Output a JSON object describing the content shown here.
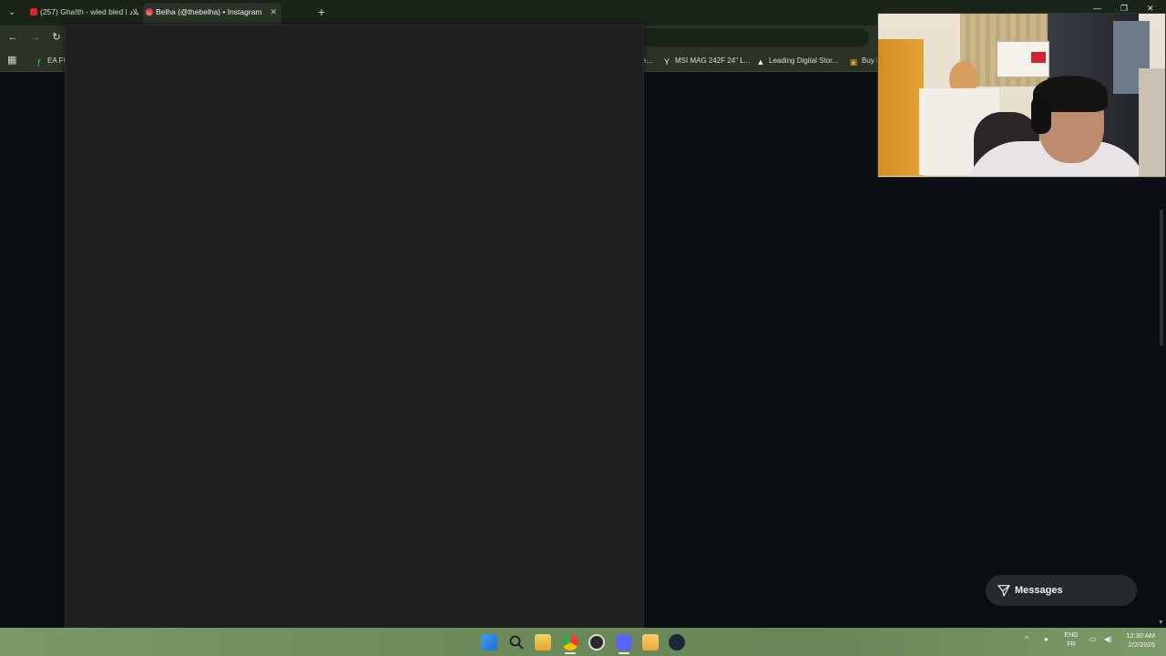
{
  "browser": {
    "tabs": [
      {
        "title": "(257) Gha!th - wled bled l بلاد",
        "favicon": "youtube-icon",
        "active": false
      },
      {
        "title": "Belha (@thebelha) • Instagram",
        "favicon": "instagram-icon",
        "active": true
      }
    ],
    "tab_close_glyph": "✕",
    "new_tab_glyph": "+",
    "tab_menu_glyph": "⌄"
  },
  "toolbar": {
    "back_glyph": "←",
    "forward_glyph": "→",
    "reload_glyph": "↻"
  },
  "bookmarks": [
    {
      "label": "EA FC",
      "icon": "ea-fc-icon"
    },
    {
      "label": "e...",
      "icon": "generic-icon"
    },
    {
      "label": "MSI MAG 242F 24\" L...",
      "icon": "msi-icon"
    },
    {
      "label": "Leading Digital Stor...",
      "icon": "store-icon"
    },
    {
      "label": "Buy I",
      "icon": "shop-icon"
    }
  ],
  "messages": {
    "label": "Messages",
    "icon": "send-icon"
  },
  "taskbar": {
    "apps": [
      "windows-start-icon",
      "search-icon",
      "file-explorer-icon",
      "chrome-icon",
      "obs-icon",
      "discord-icon",
      "notes-icon",
      "steam-icon"
    ],
    "tray_chevron": "^",
    "language": {
      "line1": "ENG",
      "line2": "FR"
    },
    "clock": {
      "time": "12:30 AM",
      "date": "2/2/2026"
    }
  },
  "colors": {
    "page_bg": "#0c1014",
    "panel_bg": "#1f1f1f",
    "chrome_bg": "#2b3327",
    "taskbar_bg": "#6f8a5c"
  }
}
